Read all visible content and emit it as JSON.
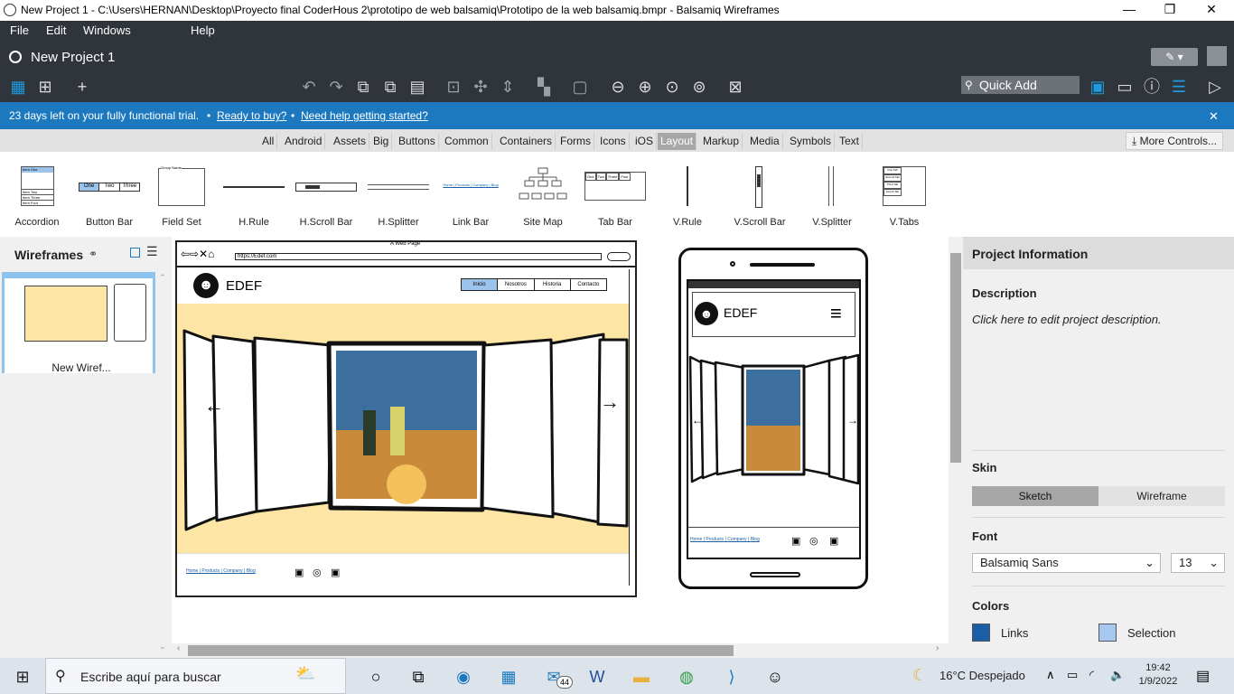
{
  "window": {
    "title": "New Project 1 - C:\\Users\\HERNAN\\Desktop\\Proyecto final CoderHous 2\\prototipo de web balsamiq\\Prototipo de la web balsamiq.bmpr - Balsamiq Wireframes",
    "minimize": "—",
    "restore": "❐",
    "close": "✕"
  },
  "menu": [
    "File",
    "Edit",
    "Windows",
    "Help"
  ],
  "project": {
    "name": "New Project 1",
    "edit_icon": "✎ ▾"
  },
  "toolbar": {
    "quick_add": "Quick Add"
  },
  "notice": {
    "trial": "23 days left on your fully functional trial.",
    "sep": "•",
    "buy": "Ready to buy?",
    "help": "Need help getting started?",
    "close": "✕"
  },
  "categories": [
    "All",
    "Android",
    "Assets",
    "Big",
    "Buttons",
    "Common",
    "Containers",
    "Forms",
    "Icons",
    "iOS",
    "Layout",
    "Markup",
    "Media",
    "Symbols",
    "Text"
  ],
  "active_category": "Layout",
  "more_controls": "More Controls...",
  "gallery": [
    "Accordion",
    "Button Bar",
    "Field Set",
    "H.Rule",
    "H.Scroll Bar",
    "H.Splitter",
    "Link Bar",
    "Site Map",
    "Tab Bar",
    "V.Rule",
    "V.Scroll Bar",
    "V.Splitter",
    "V.Tabs"
  ],
  "accordion_items": [
    "Item One",
    "Item Two",
    "Item Three",
    "Item Four"
  ],
  "button_bar": [
    "One",
    "Two",
    "Three"
  ],
  "field_set_label": "Group Name",
  "link_bar_text": "Home | Products | Company | Blog",
  "tab_bar": [
    "One",
    "Two",
    "Three",
    "Four"
  ],
  "vtabs": [
    "First Tab",
    "Second Tab",
    "Third Tab",
    "Fourth Tab"
  ],
  "wireframes": {
    "title": "Wireframes",
    "item": "New Wiref..."
  },
  "desktop": {
    "window_title": "A Web Page",
    "url": "https://Edef.com",
    "brand": "EDEF",
    "nav": [
      "Inicio",
      "Nosotros",
      "Historia",
      "Contacto"
    ],
    "footer_links": [
      "Home",
      "Products",
      "Company",
      "Blog"
    ]
  },
  "mobile": {
    "brand": "EDEF",
    "footer_links": [
      "Home",
      "Products",
      "Company",
      "Blog"
    ]
  },
  "project_info": {
    "title": "Project Information",
    "description_label": "Description",
    "description": "Click here to edit project description.",
    "skin_label": "Skin",
    "skin_options": [
      "Sketch",
      "Wireframe"
    ],
    "font_label": "Font",
    "font": "Balsamiq Sans",
    "font_size": "13",
    "colors_label": "Colors",
    "links_label": "Links",
    "selection_label": "Selection",
    "links_color": "#1a5ea8",
    "selection_color": "#a6c8f0"
  },
  "taskbar": {
    "search": "Escribe aquí para buscar",
    "mail_badge": "44",
    "weather": "16°C  Despejado",
    "time": "19:42",
    "date": "1/9/2022"
  },
  "colors": {
    "dark": "#2f353b",
    "accent": "#1d79bf",
    "canvas_bg": "#fde5a6"
  }
}
